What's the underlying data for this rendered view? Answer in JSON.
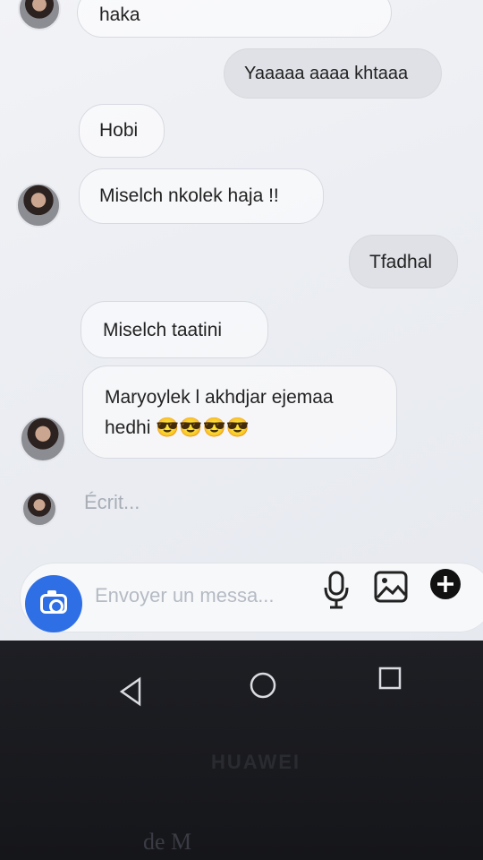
{
  "messages": [
    {
      "id": "m0",
      "text": "haka",
      "dir": "in"
    },
    {
      "id": "m1",
      "text": "Yaaaaa aaaa khtaaa",
      "dir": "out"
    },
    {
      "id": "m2",
      "text": "Hobi",
      "dir": "in"
    },
    {
      "id": "m3",
      "text": "Miselch nkolek haja !!",
      "dir": "in"
    },
    {
      "id": "m4",
      "text": "Tfadhal",
      "dir": "out"
    },
    {
      "id": "m5",
      "text": "Miselch taatini",
      "dir": "in"
    },
    {
      "id": "m6_line1",
      "text": "Maryoylek l akhdjar ejemaa",
      "dir": "in"
    },
    {
      "id": "m6_line2",
      "text": "hedhi 😎😎😎😎",
      "dir": "in"
    }
  ],
  "typing_indicator": "Écrit...",
  "composer": {
    "placeholder": "Envoyer un messa...",
    "icons": [
      "camera-icon",
      "microphone-icon",
      "image-icon",
      "plus-icon"
    ]
  },
  "navigation": {
    "icons": [
      "back-icon",
      "home-icon",
      "recents-icon"
    ]
  },
  "device_brand": "HUAWEI",
  "background_text": "de M",
  "colors": {
    "accent": "#2f6fe6",
    "bubble_out": "#dfe1e6",
    "bubble_in_border": "#d7dae1"
  }
}
